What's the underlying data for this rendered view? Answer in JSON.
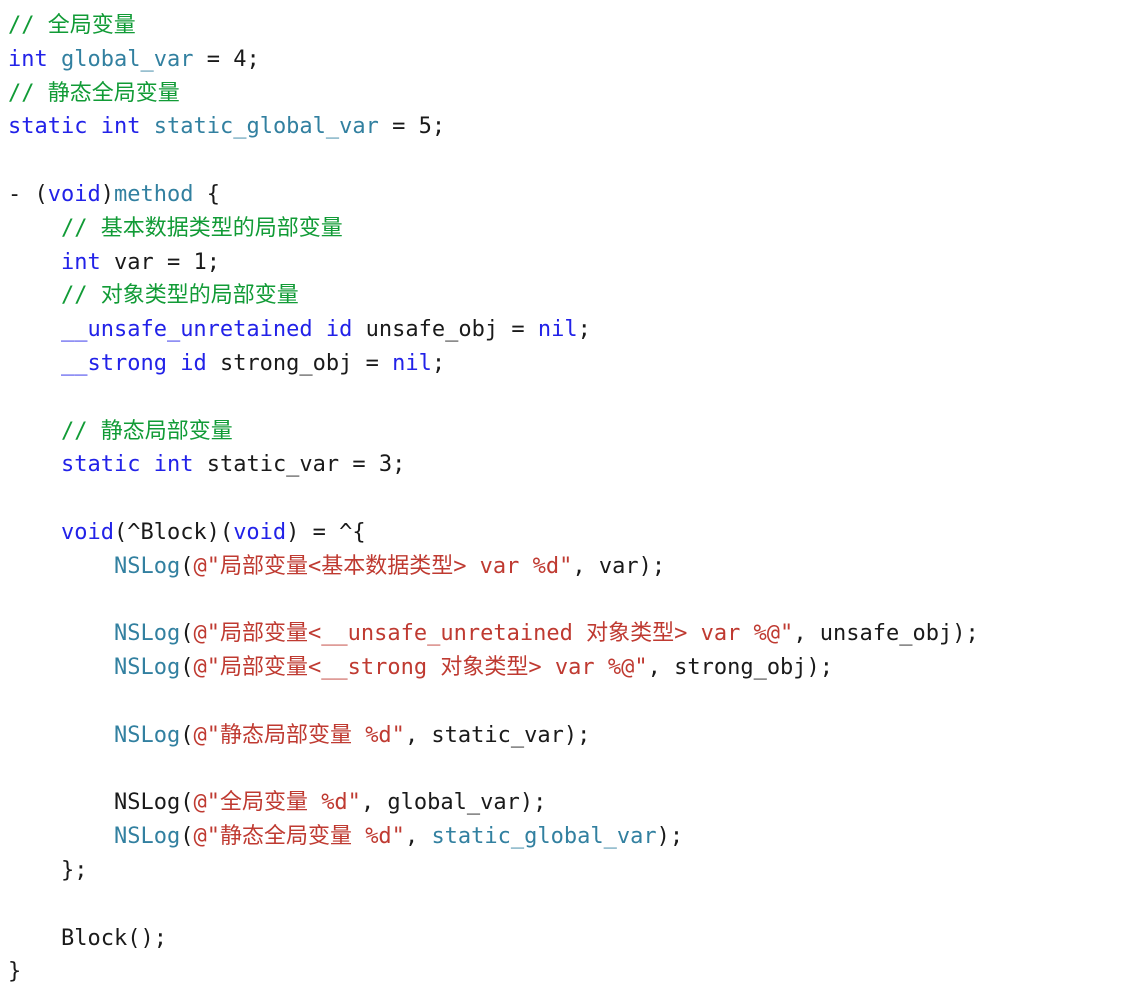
{
  "editor": {
    "language": "Objective-C",
    "background_color": "#ffffff",
    "font_size_px": 22,
    "line_height_px": 33.8,
    "indent_spaces": 4,
    "tab_width": 4
  },
  "theme": {
    "name": "light-default",
    "plain": "#1a1a1a",
    "comment": "#119b36",
    "keyword": "#2222e8",
    "type": "#2222e8",
    "identifier": "#3280a0",
    "function": "#3280a0",
    "string": "#bf3a31",
    "number": "#1a1a1a",
    "punctuation": "#1a1a1a"
  },
  "code": {
    "plain_text": "// 全局变量\nint global_var = 4;\n// 静态全局变量\nstatic int static_global_var = 5;\n\n- (void)method {\n    // 基本数据类型的局部变量\n    int var = 1;\n    // 对象类型的局部变量\n    __unsafe_unretained id unsafe_obj = nil;\n    __strong id strong_obj = nil;\n\n    // 静态局部变量\n    static int static_var = 3;\n\n    void(^Block)(void) = ^{\n        NSLog(@\"局部变量<基本数据类型> var %d\", var);\n\n        NSLog(@\"局部变量<__unsafe_unretained 对象类型> var %@\", unsafe_obj);\n        NSLog(@\"局部变量<__strong 对象类型> var %@\", strong_obj);\n\n        NSLog(@\"静态局部变量 %d\", static_var);\n\n        NSLog(@\"全局变量 %d\", global_var);\n        NSLog(@\"静态全局变量 %d\", static_global_var);\n    };\n\n    Block();\n}",
    "lines": [
      {
        "n": 1,
        "indent": 0,
        "tokens": [
          {
            "t": "// 全局变量",
            "c": "comment"
          }
        ]
      },
      {
        "n": 2,
        "indent": 0,
        "tokens": [
          {
            "t": "int",
            "c": "keyword"
          },
          {
            "t": " ",
            "c": "plain"
          },
          {
            "t": "global_var",
            "c": "ident"
          },
          {
            "t": " ",
            "c": "plain"
          },
          {
            "t": "=",
            "c": "punct"
          },
          {
            "t": " ",
            "c": "plain"
          },
          {
            "t": "4",
            "c": "number"
          },
          {
            "t": ";",
            "c": "punct"
          }
        ]
      },
      {
        "n": 3,
        "indent": 0,
        "tokens": [
          {
            "t": "// 静态全局变量",
            "c": "comment"
          }
        ]
      },
      {
        "n": 4,
        "indent": 0,
        "tokens": [
          {
            "t": "static",
            "c": "keyword"
          },
          {
            "t": " ",
            "c": "plain"
          },
          {
            "t": "int",
            "c": "keyword"
          },
          {
            "t": " ",
            "c": "plain"
          },
          {
            "t": "static_global_var",
            "c": "ident"
          },
          {
            "t": " ",
            "c": "plain"
          },
          {
            "t": "=",
            "c": "punct"
          },
          {
            "t": " ",
            "c": "plain"
          },
          {
            "t": "5",
            "c": "number"
          },
          {
            "t": ";",
            "c": "punct"
          }
        ]
      },
      {
        "n": 5,
        "indent": 0,
        "blank": true,
        "tokens": []
      },
      {
        "n": 6,
        "indent": 0,
        "tokens": [
          {
            "t": "- (",
            "c": "plain"
          },
          {
            "t": "void",
            "c": "keyword"
          },
          {
            "t": ")",
            "c": "plain"
          },
          {
            "t": "method",
            "c": "func"
          },
          {
            "t": " {",
            "c": "plain"
          }
        ]
      },
      {
        "n": 7,
        "indent": 4,
        "tokens": [
          {
            "t": "// 基本数据类型的局部变量",
            "c": "comment"
          }
        ]
      },
      {
        "n": 8,
        "indent": 4,
        "tokens": [
          {
            "t": "int",
            "c": "keyword"
          },
          {
            "t": " var = ",
            "c": "plain"
          },
          {
            "t": "1",
            "c": "number"
          },
          {
            "t": ";",
            "c": "punct"
          }
        ]
      },
      {
        "n": 9,
        "indent": 4,
        "tokens": [
          {
            "t": "// 对象类型的局部变量",
            "c": "comment"
          }
        ]
      },
      {
        "n": 10,
        "indent": 4,
        "tokens": [
          {
            "t": "__unsafe_unretained",
            "c": "keyword"
          },
          {
            "t": " ",
            "c": "plain"
          },
          {
            "t": "id",
            "c": "keyword"
          },
          {
            "t": " unsafe_obj = ",
            "c": "plain"
          },
          {
            "t": "nil",
            "c": "keyword"
          },
          {
            "t": ";",
            "c": "punct"
          }
        ]
      },
      {
        "n": 11,
        "indent": 4,
        "tokens": [
          {
            "t": "__strong",
            "c": "keyword"
          },
          {
            "t": " ",
            "c": "plain"
          },
          {
            "t": "id",
            "c": "keyword"
          },
          {
            "t": " strong_obj = ",
            "c": "plain"
          },
          {
            "t": "nil",
            "c": "keyword"
          },
          {
            "t": ";",
            "c": "punct"
          }
        ]
      },
      {
        "n": 12,
        "indent": 0,
        "blank": true,
        "tokens": []
      },
      {
        "n": 13,
        "indent": 4,
        "tokens": [
          {
            "t": "// 静态局部变量",
            "c": "comment"
          }
        ]
      },
      {
        "n": 14,
        "indent": 4,
        "tokens": [
          {
            "t": "static",
            "c": "keyword"
          },
          {
            "t": " ",
            "c": "plain"
          },
          {
            "t": "int",
            "c": "keyword"
          },
          {
            "t": " static_var = ",
            "c": "plain"
          },
          {
            "t": "3",
            "c": "number"
          },
          {
            "t": ";",
            "c": "punct"
          }
        ]
      },
      {
        "n": 15,
        "indent": 0,
        "blank": true,
        "tokens": []
      },
      {
        "n": 16,
        "indent": 4,
        "tokens": [
          {
            "t": "void",
            "c": "keyword"
          },
          {
            "t": "(^Block)(",
            "c": "plain"
          },
          {
            "t": "void",
            "c": "keyword"
          },
          {
            "t": ") = ^{",
            "c": "plain"
          }
        ]
      },
      {
        "n": 17,
        "indent": 8,
        "tokens": [
          {
            "t": "NSLog",
            "c": "func"
          },
          {
            "t": "(",
            "c": "plain"
          },
          {
            "t": "@\"局部变量<基本数据类型> var %d\"",
            "c": "string"
          },
          {
            "t": ", var);",
            "c": "plain"
          }
        ]
      },
      {
        "n": 18,
        "indent": 0,
        "blank": true,
        "tokens": []
      },
      {
        "n": 19,
        "indent": 8,
        "tokens": [
          {
            "t": "NSLog",
            "c": "func"
          },
          {
            "t": "(",
            "c": "plain"
          },
          {
            "t": "@\"局部变量<__unsafe_unretained 对象类型> var %@\"",
            "c": "string"
          },
          {
            "t": ", unsafe_obj);",
            "c": "plain"
          }
        ]
      },
      {
        "n": 20,
        "indent": 8,
        "tokens": [
          {
            "t": "NSLog",
            "c": "func"
          },
          {
            "t": "(",
            "c": "plain"
          },
          {
            "t": "@\"局部变量<__strong 对象类型> var %@\"",
            "c": "string"
          },
          {
            "t": ", strong_obj);",
            "c": "plain"
          }
        ]
      },
      {
        "n": 21,
        "indent": 0,
        "blank": true,
        "tokens": []
      },
      {
        "n": 22,
        "indent": 8,
        "tokens": [
          {
            "t": "NSLog",
            "c": "func"
          },
          {
            "t": "(",
            "c": "plain"
          },
          {
            "t": "@\"静态局部变量 %d\"",
            "c": "string"
          },
          {
            "t": ", static_var);",
            "c": "plain"
          }
        ]
      },
      {
        "n": 23,
        "indent": 0,
        "blank": true,
        "tokens": []
      },
      {
        "n": 24,
        "indent": 8,
        "tokens": [
          {
            "t": "NSLog",
            "c": "plain"
          },
          {
            "t": "(",
            "c": "plain"
          },
          {
            "t": "@\"全局变量 %d\"",
            "c": "string"
          },
          {
            "t": ", global_var);",
            "c": "plain"
          }
        ]
      },
      {
        "n": 25,
        "indent": 8,
        "tokens": [
          {
            "t": "NSLog",
            "c": "func"
          },
          {
            "t": "(",
            "c": "plain"
          },
          {
            "t": "@\"静态全局变量 %d\"",
            "c": "string"
          },
          {
            "t": ", ",
            "c": "plain"
          },
          {
            "t": "static_global_var",
            "c": "ident"
          },
          {
            "t": ");",
            "c": "plain"
          }
        ]
      },
      {
        "n": 26,
        "indent": 4,
        "tokens": [
          {
            "t": "};",
            "c": "plain"
          }
        ]
      },
      {
        "n": 27,
        "indent": 0,
        "blank": true,
        "tokens": []
      },
      {
        "n": 28,
        "indent": 4,
        "tokens": [
          {
            "t": "Block();",
            "c": "plain"
          }
        ]
      },
      {
        "n": 29,
        "indent": 0,
        "tokens": [
          {
            "t": "}",
            "c": "plain"
          }
        ]
      }
    ]
  }
}
